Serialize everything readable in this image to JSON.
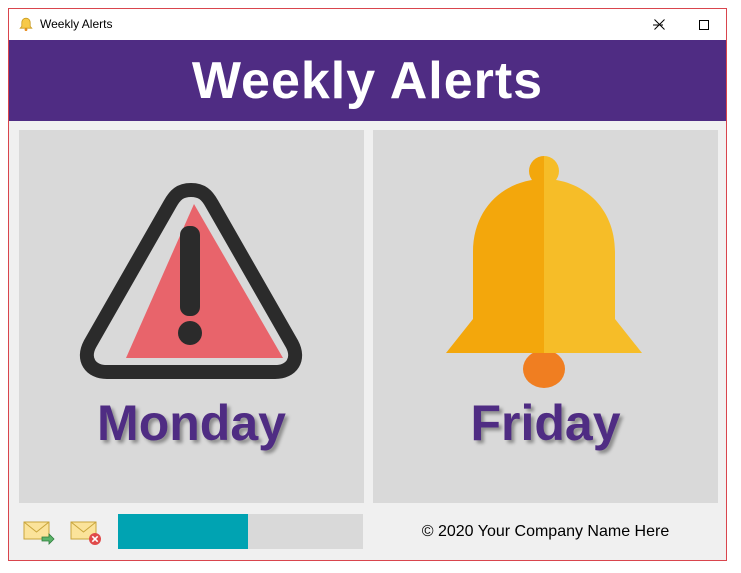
{
  "window": {
    "title": "Weekly Alerts",
    "icon": "bell-icon"
  },
  "controls": {
    "minimize_icon": "minimize-icon",
    "maximize_icon": "maximize-icon",
    "close_icon": "close-icon"
  },
  "header": {
    "title": "Weekly Alerts",
    "background": "#4f2c83"
  },
  "panels": [
    {
      "label": "Monday",
      "icon": "warning-icon"
    },
    {
      "label": "Friday",
      "icon": "bell-icon"
    }
  ],
  "statusbar": {
    "send_icon": "mail-send-icon",
    "delete_icon": "mail-delete-icon",
    "progress_percent": 53,
    "progress_color": "#00a3b2",
    "copyright": "© 2020 Your Company Name Here"
  }
}
